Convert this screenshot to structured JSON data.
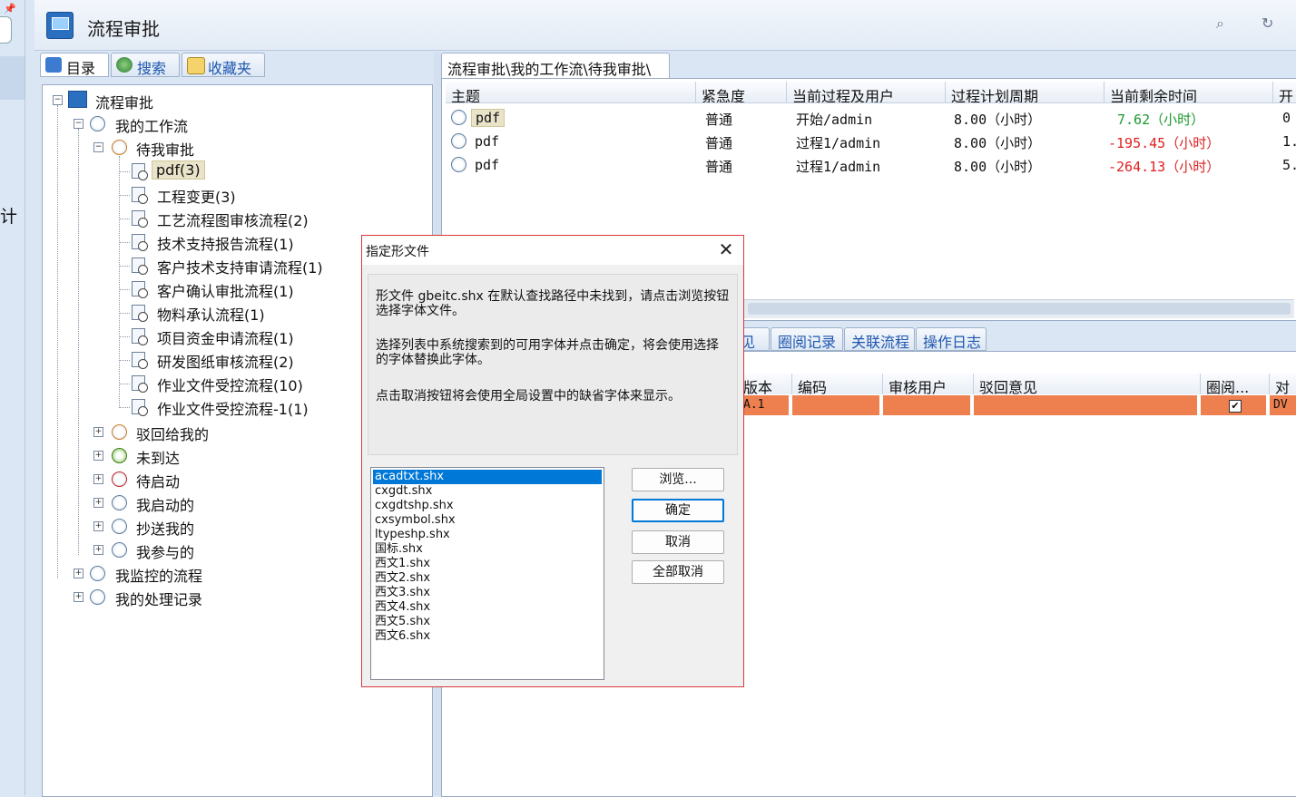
{
  "header": {
    "title": "流程审批"
  },
  "left_strip": {
    "partial_text": "计"
  },
  "left_tabs": [
    {
      "label": "目录"
    },
    {
      "label": "搜索"
    },
    {
      "label": "收藏夹"
    }
  ],
  "tree": {
    "root": "流程审批",
    "my_workflow": "我的工作流",
    "pending": "待我审批",
    "pending_children": [
      "pdf(3)",
      "工程变更(3)",
      "工艺流程图审核流程(2)",
      "技术支持报告流程(1)",
      "客户技术支持审请流程(1)",
      "客户确认审批流程(1)",
      "物料承认流程(1)",
      "项目资金申请流程(1)",
      "研发图纸审核流程(2)",
      "作业文件受控流程(10)",
      "作业文件受控流程-1(1)"
    ],
    "siblings": [
      "驳回给我的",
      "未到达",
      "待启动",
      "我启动的",
      "抄送我的",
      "我参与的"
    ],
    "monitored": "我监控的流程",
    "records": "我的处理记录"
  },
  "breadcrumb_tab": "流程审批\\我的工作流\\待我审批\\",
  "top_grid": {
    "columns": [
      "主题",
      "紧急度",
      "当前过程及用户",
      "过程计划周期",
      "当前剩余时间",
      "开"
    ],
    "rows": [
      {
        "subject": "pdf",
        "urgency": "普通",
        "process": "开始/admin",
        "period": "8.00（小时）",
        "remaining": "7.62（小时）",
        "extra": "0"
      },
      {
        "subject": "pdf",
        "urgency": "普通",
        "process": "过程1/admin",
        "period": "8.00（小时）",
        "remaining": "-195.45（小时）",
        "extra": "1."
      },
      {
        "subject": "pdf",
        "urgency": "普通",
        "process": "过程1/admin",
        "period": "8.00（小时）",
        "remaining": "-264.13（小时）",
        "extra": "5."
      }
    ]
  },
  "bottom_tabs": [
    "见",
    "圈阅记录",
    "关联流程",
    "操作日志"
  ],
  "bottom_grid": {
    "columns": [
      "版本",
      "编码",
      "审核用户",
      "驳回意见",
      "圈阅...",
      "对"
    ],
    "row": {
      "version": "A.1",
      "checked": "✔",
      "extra": "DV"
    }
  },
  "dialog": {
    "title": "指定形文件",
    "msg1": "形文件 gbeitc.shx 在默认查找路径中未找到，请点击浏览按钮选择字体文件。",
    "msg2": "选择列表中系统搜索到的可用字体并点击确定，将会使用选择的字体替换此字体。",
    "msg3": "点击取消按钮将会使用全局设置中的缺省字体来显示。",
    "fonts": [
      "acadtxt.shx",
      "cxgdt.shx",
      "cxgdtshp.shx",
      "cxsymbol.shx",
      "ltypeshp.shx",
      "国标.shx",
      "西文1.shx",
      "西文2.shx",
      "西文3.shx",
      "西文4.shx",
      "西文5.shx",
      "西文6.shx"
    ],
    "btn_browse": "浏览...",
    "btn_ok": "确定",
    "btn_cancel": "取消",
    "btn_cancel_all": "全部取消",
    "close": "✕"
  },
  "colors": {
    "accent": "#0078d7",
    "row_highlight": "#ee7f4f",
    "positive": "#1a9a2a",
    "negative": "#e02020",
    "dialog_border": "#d83a3a"
  }
}
